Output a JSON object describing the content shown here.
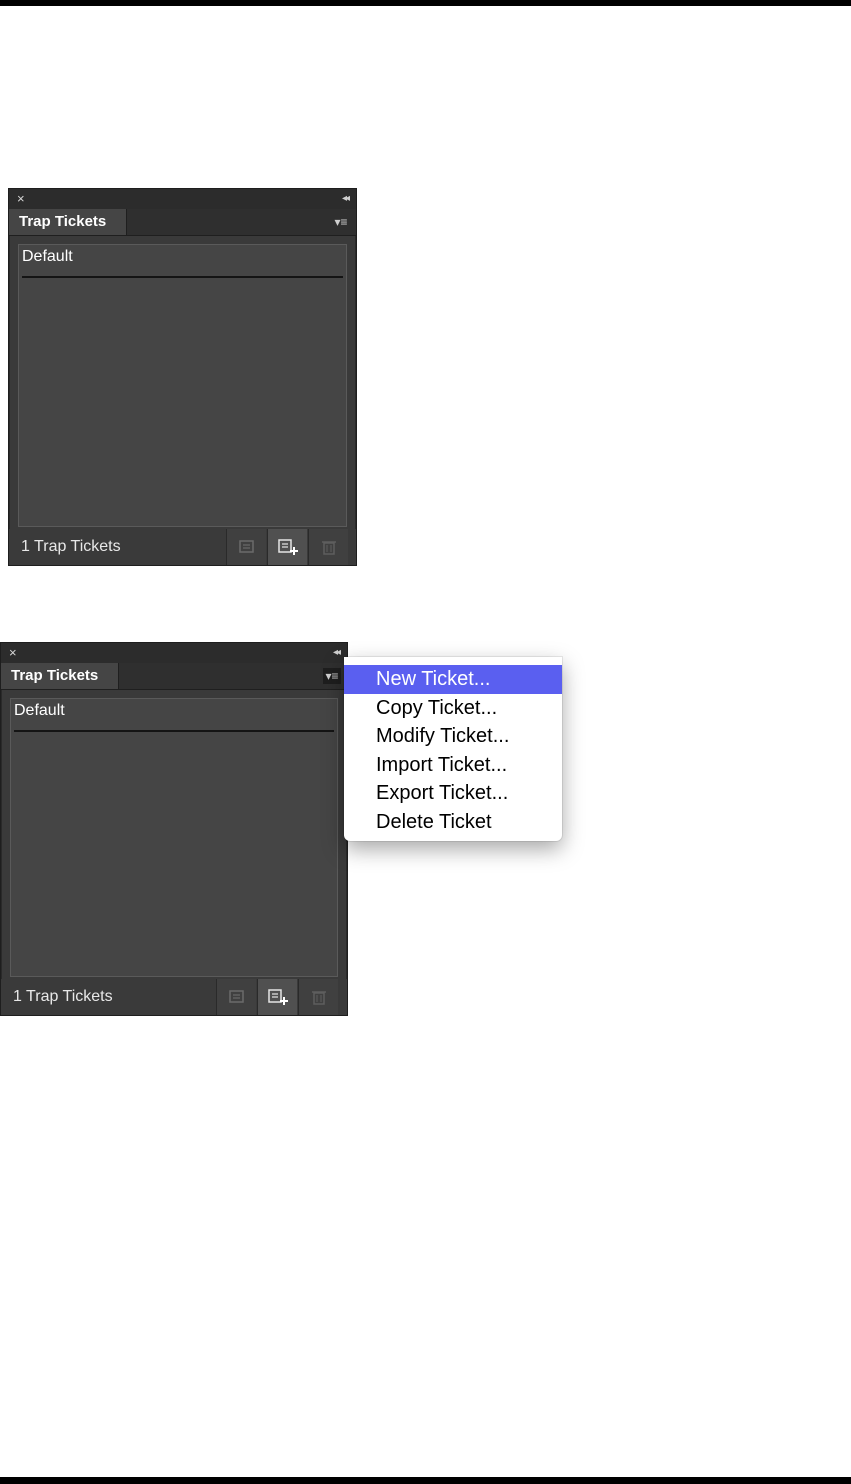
{
  "panels": [
    {
      "close_glyph": "×",
      "collapse_glyph": "◂◂",
      "tab_label": "Trap Tickets",
      "menu_glyph": "▾≡",
      "list_items": [
        "Default"
      ],
      "footer_count": "1 Trap Tickets"
    },
    {
      "close_glyph": "×",
      "collapse_glyph": "◂◂",
      "tab_label": "Trap Tickets",
      "menu_glyph": "▾≡",
      "list_items": [
        "Default"
      ],
      "footer_count": "1 Trap Tickets"
    }
  ],
  "flyout_menu": {
    "items": [
      {
        "label": "New Ticket...",
        "highlighted": true
      },
      {
        "label": "Copy Ticket...",
        "highlighted": false
      },
      {
        "label": "Modify Ticket...",
        "highlighted": false
      },
      {
        "label": "Import Ticket...",
        "highlighted": false
      },
      {
        "label": "Export Ticket...",
        "highlighted": false
      },
      {
        "label": "Delete Ticket",
        "highlighted": false
      }
    ]
  },
  "icons": {
    "footer_buttons": [
      "ticket-settings-icon",
      "new-ticket-icon",
      "trash-icon"
    ]
  },
  "colors": {
    "panel_bg": "#3a3a3a",
    "menu_highlight": "#5a5ff0"
  }
}
